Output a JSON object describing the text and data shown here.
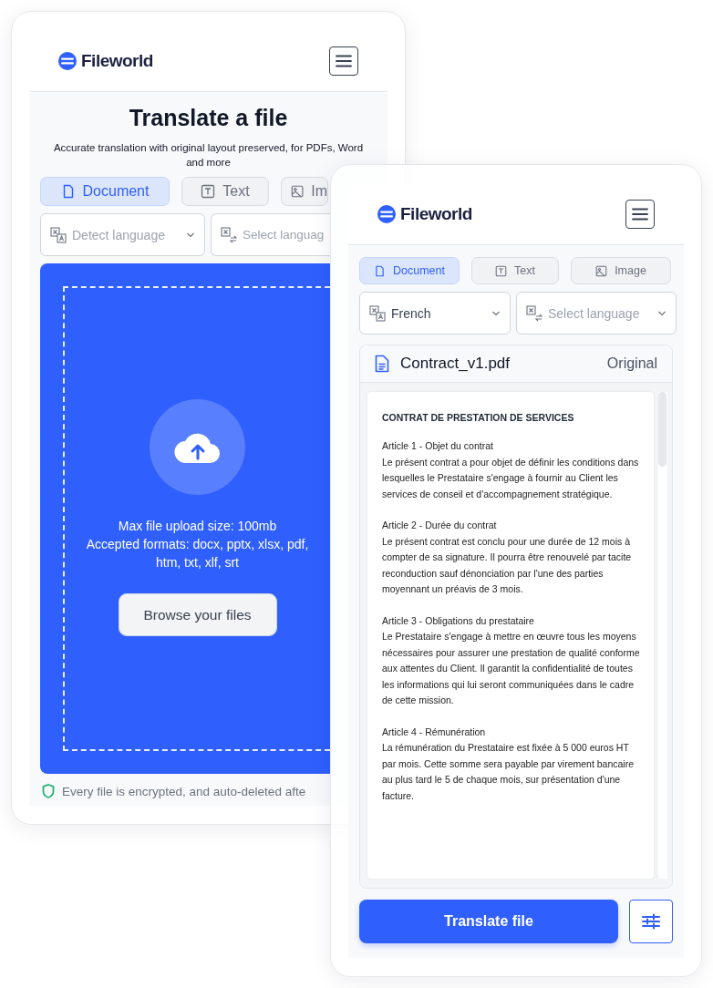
{
  "back_screen": {
    "brand": "Fileworld",
    "title": "Translate a file",
    "subtitle": "Accurate translation with original layout preserved, for PDFs, Word and more",
    "tabs": [
      {
        "label": "Document",
        "kind": "document",
        "selected": true
      },
      {
        "label": "Text",
        "kind": "text",
        "selected": false
      },
      {
        "label": "Im",
        "kind": "image",
        "selected": false
      }
    ],
    "language_fields": [
      {
        "kind": "source",
        "placeholder": "Detect language"
      },
      {
        "kind": "target",
        "placeholder": "Select languag"
      }
    ],
    "upload": {
      "info_lines": [
        "Max file upload size: 100mb",
        "Accepted formats: docx, pptx, xlsx, pdf,",
        "htm, txt, xlf, srt"
      ],
      "button": "Browse your files"
    },
    "note": "Every file is encrypted, and auto-deleted afte"
  },
  "front_screen": {
    "brand": "Fileworld",
    "tabs": [
      {
        "label": "Document",
        "kind": "document",
        "selected": true
      },
      {
        "label": "Text",
        "kind": "text",
        "selected": false
      },
      {
        "label": "Image",
        "kind": "image",
        "selected": false
      }
    ],
    "language_fields": [
      {
        "kind": "source",
        "value": "French"
      },
      {
        "kind": "target",
        "placeholder": "Select language"
      }
    ],
    "file": {
      "name": "Contract_v1.pdf",
      "status": "Original",
      "doc_title": "CONTRAT DE PRESTATION DE SERVICES",
      "articles": [
        {
          "heading": "Article 1 - Objet du contrat",
          "body": "Le présent contrat a pour objet de définir les conditions dans lesquelles le Prestataire s'engage à fournir au Client les services de conseil et d'accompagnement stratégique."
        },
        {
          "heading": "Article 2 - Durée du contrat",
          "body": "Le présent contrat est conclu pour une durée de 12 mois à compter de sa signature. Il pourra être renouvelé par tacite reconduction sauf dénonciation par l'une des parties moyennant un préavis de 3 mois."
        },
        {
          "heading": "Article 3 - Obligations du prestataire",
          "body": "Le Prestataire s'engage à mettre en œuvre tous les moyens nécessaires pour assurer une prestation de qualité conforme aux attentes du Client. Il garantit la confidentialité de toutes les informations qui lui seront communiquées dans le cadre de cette mission."
        },
        {
          "heading": "Article 4 - Rémunération",
          "body": "La rémunération du Prestataire est fixée à 5 000 euros HT par mois. Cette somme sera payable par virement bancaire au plus tard le 5 de chaque mois, sur présentation d'une facture."
        }
      ]
    },
    "primary_button": "Translate file"
  }
}
